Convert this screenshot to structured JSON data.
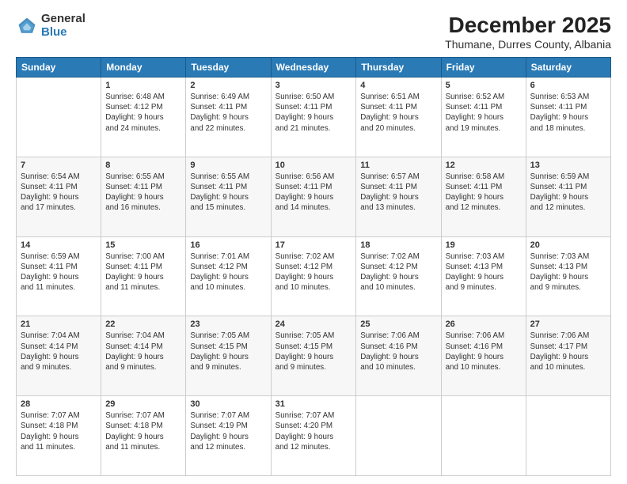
{
  "logo": {
    "general": "General",
    "blue": "Blue"
  },
  "header": {
    "month": "December 2025",
    "location": "Thumane, Durres County, Albania"
  },
  "weekdays": [
    "Sunday",
    "Monday",
    "Tuesday",
    "Wednesday",
    "Thursday",
    "Friday",
    "Saturday"
  ],
  "weeks": [
    [
      {
        "day": "",
        "info": ""
      },
      {
        "day": "1",
        "info": "Sunrise: 6:48 AM\nSunset: 4:12 PM\nDaylight: 9 hours\nand 24 minutes."
      },
      {
        "day": "2",
        "info": "Sunrise: 6:49 AM\nSunset: 4:11 PM\nDaylight: 9 hours\nand 22 minutes."
      },
      {
        "day": "3",
        "info": "Sunrise: 6:50 AM\nSunset: 4:11 PM\nDaylight: 9 hours\nand 21 minutes."
      },
      {
        "day": "4",
        "info": "Sunrise: 6:51 AM\nSunset: 4:11 PM\nDaylight: 9 hours\nand 20 minutes."
      },
      {
        "day": "5",
        "info": "Sunrise: 6:52 AM\nSunset: 4:11 PM\nDaylight: 9 hours\nand 19 minutes."
      },
      {
        "day": "6",
        "info": "Sunrise: 6:53 AM\nSunset: 4:11 PM\nDaylight: 9 hours\nand 18 minutes."
      }
    ],
    [
      {
        "day": "7",
        "info": "Sunrise: 6:54 AM\nSunset: 4:11 PM\nDaylight: 9 hours\nand 17 minutes."
      },
      {
        "day": "8",
        "info": "Sunrise: 6:55 AM\nSunset: 4:11 PM\nDaylight: 9 hours\nand 16 minutes."
      },
      {
        "day": "9",
        "info": "Sunrise: 6:55 AM\nSunset: 4:11 PM\nDaylight: 9 hours\nand 15 minutes."
      },
      {
        "day": "10",
        "info": "Sunrise: 6:56 AM\nSunset: 4:11 PM\nDaylight: 9 hours\nand 14 minutes."
      },
      {
        "day": "11",
        "info": "Sunrise: 6:57 AM\nSunset: 4:11 PM\nDaylight: 9 hours\nand 13 minutes."
      },
      {
        "day": "12",
        "info": "Sunrise: 6:58 AM\nSunset: 4:11 PM\nDaylight: 9 hours\nand 12 minutes."
      },
      {
        "day": "13",
        "info": "Sunrise: 6:59 AM\nSunset: 4:11 PM\nDaylight: 9 hours\nand 12 minutes."
      }
    ],
    [
      {
        "day": "14",
        "info": "Sunrise: 6:59 AM\nSunset: 4:11 PM\nDaylight: 9 hours\nand 11 minutes."
      },
      {
        "day": "15",
        "info": "Sunrise: 7:00 AM\nSunset: 4:11 PM\nDaylight: 9 hours\nand 11 minutes."
      },
      {
        "day": "16",
        "info": "Sunrise: 7:01 AM\nSunset: 4:12 PM\nDaylight: 9 hours\nand 10 minutes."
      },
      {
        "day": "17",
        "info": "Sunrise: 7:02 AM\nSunset: 4:12 PM\nDaylight: 9 hours\nand 10 minutes."
      },
      {
        "day": "18",
        "info": "Sunrise: 7:02 AM\nSunset: 4:12 PM\nDaylight: 9 hours\nand 10 minutes."
      },
      {
        "day": "19",
        "info": "Sunrise: 7:03 AM\nSunset: 4:13 PM\nDaylight: 9 hours\nand 9 minutes."
      },
      {
        "day": "20",
        "info": "Sunrise: 7:03 AM\nSunset: 4:13 PM\nDaylight: 9 hours\nand 9 minutes."
      }
    ],
    [
      {
        "day": "21",
        "info": "Sunrise: 7:04 AM\nSunset: 4:14 PM\nDaylight: 9 hours\nand 9 minutes."
      },
      {
        "day": "22",
        "info": "Sunrise: 7:04 AM\nSunset: 4:14 PM\nDaylight: 9 hours\nand 9 minutes."
      },
      {
        "day": "23",
        "info": "Sunrise: 7:05 AM\nSunset: 4:15 PM\nDaylight: 9 hours\nand 9 minutes."
      },
      {
        "day": "24",
        "info": "Sunrise: 7:05 AM\nSunset: 4:15 PM\nDaylight: 9 hours\nand 9 minutes."
      },
      {
        "day": "25",
        "info": "Sunrise: 7:06 AM\nSunset: 4:16 PM\nDaylight: 9 hours\nand 10 minutes."
      },
      {
        "day": "26",
        "info": "Sunrise: 7:06 AM\nSunset: 4:16 PM\nDaylight: 9 hours\nand 10 minutes."
      },
      {
        "day": "27",
        "info": "Sunrise: 7:06 AM\nSunset: 4:17 PM\nDaylight: 9 hours\nand 10 minutes."
      }
    ],
    [
      {
        "day": "28",
        "info": "Sunrise: 7:07 AM\nSunset: 4:18 PM\nDaylight: 9 hours\nand 11 minutes."
      },
      {
        "day": "29",
        "info": "Sunrise: 7:07 AM\nSunset: 4:18 PM\nDaylight: 9 hours\nand 11 minutes."
      },
      {
        "day": "30",
        "info": "Sunrise: 7:07 AM\nSunset: 4:19 PM\nDaylight: 9 hours\nand 12 minutes."
      },
      {
        "day": "31",
        "info": "Sunrise: 7:07 AM\nSunset: 4:20 PM\nDaylight: 9 hours\nand 12 minutes."
      },
      {
        "day": "",
        "info": ""
      },
      {
        "day": "",
        "info": ""
      },
      {
        "day": "",
        "info": ""
      }
    ]
  ]
}
